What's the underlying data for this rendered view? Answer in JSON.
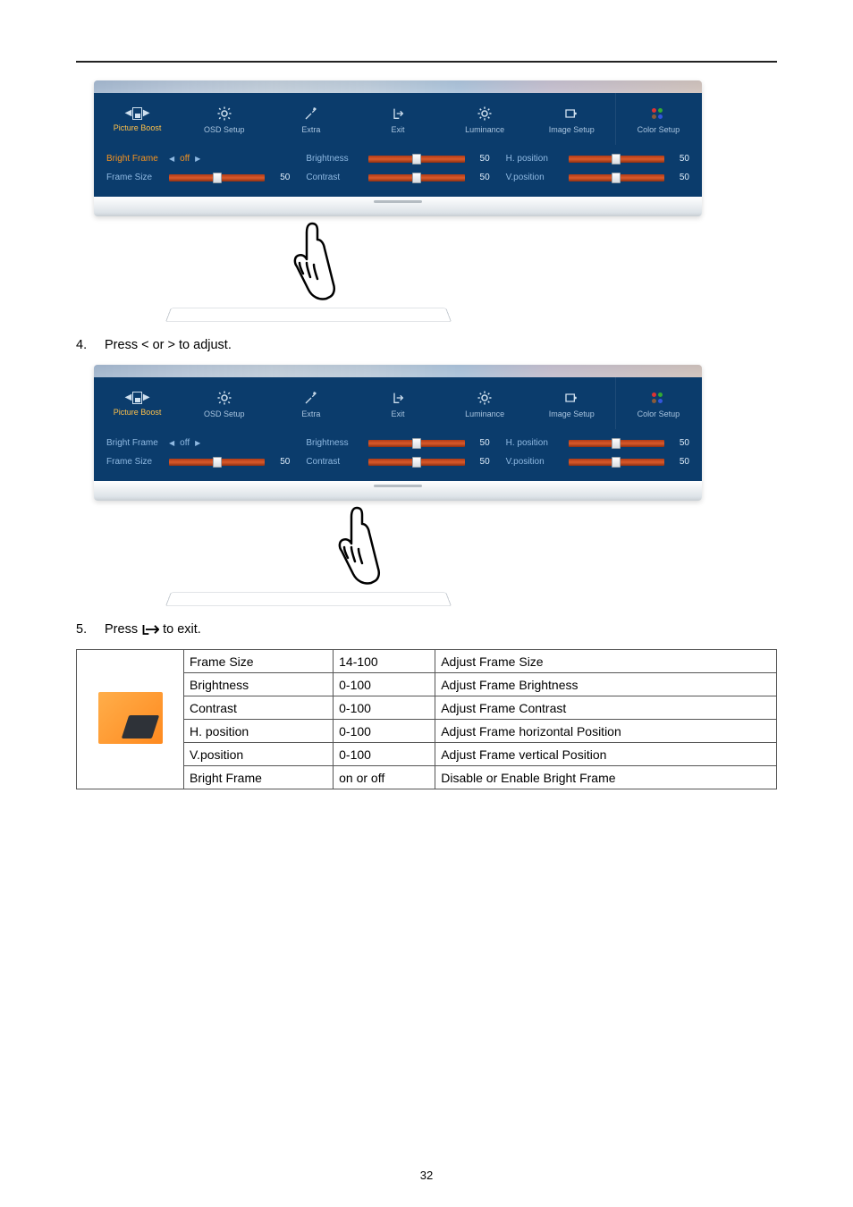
{
  "tabs": {
    "picture_boost": "Picture Boost",
    "osd_setup": "OSD Setup",
    "extra": "Extra",
    "exit": "Exit",
    "luminance": "Luminance",
    "image_setup": "Image Setup",
    "color_setup": "Color Setup"
  },
  "osd1": {
    "bright_frame_label": "Bright Frame",
    "bright_frame_opt": "off",
    "frame_size_label": "Frame Size",
    "frame_size_val": "50",
    "brightness_label": "Brightness",
    "brightness_val": "50",
    "contrast_label": "Contrast",
    "contrast_val": "50",
    "hpos_label": "H. position",
    "hpos_val": "50",
    "vpos_label": "V.position",
    "vpos_val": "50"
  },
  "osd2": {
    "bright_frame_label": "Bright Frame",
    "bright_frame_opt": "off",
    "frame_size_label": "Frame Size",
    "frame_size_val": "50",
    "brightness_label": "Brightness",
    "brightness_val": "50",
    "contrast_label": "Contrast",
    "contrast_val": "50",
    "hpos_label": "H. position",
    "hpos_val": "50",
    "vpos_label": "V.position",
    "vpos_val": "50"
  },
  "step4": {
    "num": "4.",
    "text": "Press < or > to adjust."
  },
  "step5": {
    "num": "5.",
    "text_before": "Press",
    "text_after": "to exit."
  },
  "table": {
    "rows": [
      {
        "name": "Frame Size",
        "range": "14-100",
        "desc": "Adjust Frame Size"
      },
      {
        "name": "Brightness",
        "range": "0-100",
        "desc": "Adjust Frame Brightness"
      },
      {
        "name": "Contrast",
        "range": "0-100",
        "desc": "Adjust Frame Contrast"
      },
      {
        "name": "H. position",
        "range": "0-100",
        "desc": "Adjust Frame horizontal Position"
      },
      {
        "name": "V.position",
        "range": "0-100",
        "desc": "Adjust Frame vertical Position"
      },
      {
        "name": "Bright Frame",
        "range": "on or off",
        "desc": "Disable or Enable Bright Frame"
      }
    ]
  },
  "page_number": "32"
}
